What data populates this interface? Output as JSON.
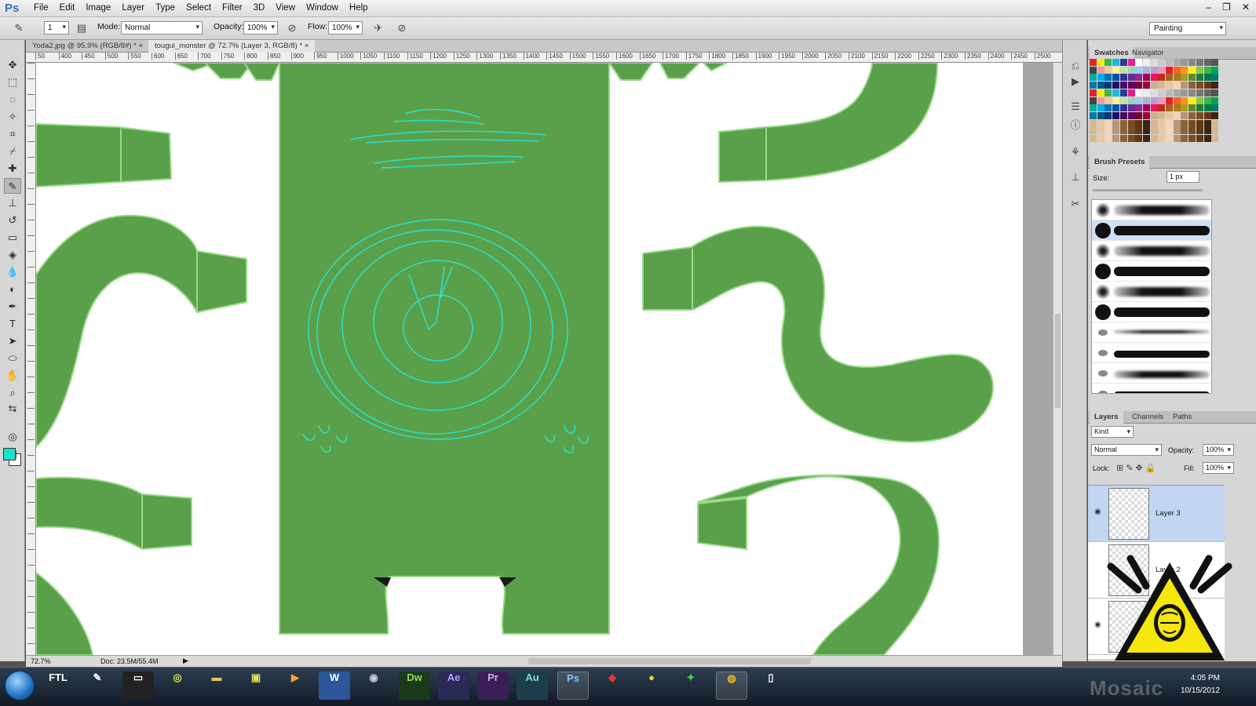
{
  "app": {
    "logo": "Ps"
  },
  "menu": [
    "File",
    "Edit",
    "Image",
    "Layer",
    "Type",
    "Select",
    "Filter",
    "3D",
    "View",
    "Window",
    "Help"
  ],
  "window_controls": [
    "–",
    "❐",
    "✕"
  ],
  "options": {
    "brush_size": "1",
    "mode_label": "Mode:",
    "mode_value": "Normal",
    "opacity_label": "Opacity:",
    "opacity_value": "100%",
    "flow_label": "Flow:",
    "flow_value": "100%"
  },
  "workspace": "Painting",
  "documents": [
    {
      "label": "Yoda2.jpg @ 95.9% (RGB/8#) *",
      "close": "×"
    },
    {
      "label": "tougui_monster @ 72.7% (Layer 3, RGB/8) *",
      "close": "×"
    }
  ],
  "ruler_ticks": [
    "50",
    "400",
    "450",
    "500",
    "550",
    "600",
    "650",
    "700",
    "750",
    "800",
    "850",
    "900",
    "950",
    "1000",
    "1050",
    "1100",
    "1150",
    "1200",
    "1250",
    "1300",
    "1350",
    "1400",
    "1450",
    "1500",
    "1550",
    "1600",
    "1650",
    "1700",
    "1750",
    "1800",
    "1850",
    "1900",
    "1950",
    "2000",
    "2050",
    "2100",
    "2150",
    "2200",
    "2250",
    "2300",
    "2350",
    "2400",
    "2450",
    "2500"
  ],
  "status": {
    "zoom": "72.7%",
    "doc": "Doc: 23.5M/55.4M"
  },
  "colors": {
    "foreground": "#19e1d0",
    "background": "#ffffff",
    "shape_green": "#5aa04b",
    "shape_outline": "#9ad88a",
    "sketch": "#27e6d4",
    "selected_blue": "#c2d6f2"
  },
  "panels": {
    "swatches_tabs": [
      "Swatches",
      "Navigator"
    ],
    "brush_presets": {
      "title": "Brush Presets",
      "size_label": "Size:",
      "size_value": "1 px"
    },
    "layers_tabs": [
      "Layers",
      "Channels",
      "Paths"
    ],
    "layers_kind": "Kind",
    "blend_mode": "Normal",
    "opacity_label": "Opacity:",
    "opacity_value": "100%",
    "lock_label": "Lock:",
    "fill_label": "Fill:",
    "fill_value": "100%",
    "layers": [
      {
        "name": "Layer 3",
        "selected": true
      },
      {
        "name": "Layer 2",
        "selected": false
      },
      {
        "name": "",
        "selected": false
      }
    ]
  },
  "taskbar": {
    "apps": [
      "FTL",
      "",
      "",
      "",
      "",
      "",
      "",
      "W",
      "",
      "Dw",
      "Ae",
      "Pr",
      "Au",
      "Ps",
      "",
      "",
      "",
      "",
      ""
    ],
    "time": "4:05 PM",
    "date": "10/15/2012"
  },
  "watermark": "Mosaic"
}
